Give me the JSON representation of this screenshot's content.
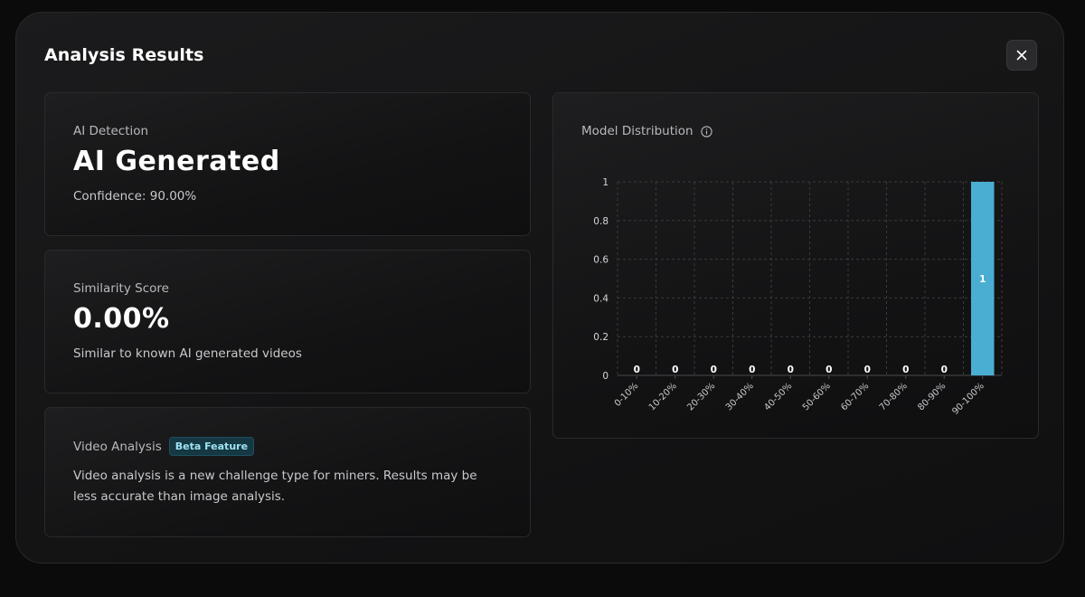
{
  "modal": {
    "title": "Analysis Results",
    "close_icon": "close-icon"
  },
  "ai_detection": {
    "label": "AI Detection",
    "value": "AI Generated",
    "confidence": "Confidence: 90.00%"
  },
  "similarity": {
    "label": "Similarity Score",
    "value": "0.00%",
    "description": "Similar to known AI generated videos"
  },
  "video_analysis": {
    "label": "Video Analysis",
    "badge": "Beta Feature",
    "badge_color": "#9fe3f4",
    "description": "Video analysis is a new challenge type for miners. Results may be less accurate than image analysis."
  },
  "chart_panel": {
    "title": "Model Distribution",
    "info_icon": "info-icon"
  },
  "chart_data": {
    "type": "bar",
    "title": "Model Distribution",
    "xlabel": "",
    "ylabel": "",
    "categories": [
      "0-10%",
      "10-20%",
      "20-30%",
      "30-40%",
      "40-50%",
      "50-60%",
      "60-70%",
      "70-80%",
      "80-90%",
      "90-100%"
    ],
    "values": [
      0,
      0,
      0,
      0,
      0,
      0,
      0,
      0,
      0,
      1
    ],
    "yticks": [
      "0",
      "0.2",
      "0.4",
      "0.6",
      "0.8",
      "1"
    ],
    "ylim": [
      0,
      1
    ],
    "grid": true,
    "bar_color": "#4aaed3",
    "data_labels": [
      "0",
      "0",
      "0",
      "0",
      "0",
      "0",
      "0",
      "0",
      "0",
      "1"
    ]
  }
}
